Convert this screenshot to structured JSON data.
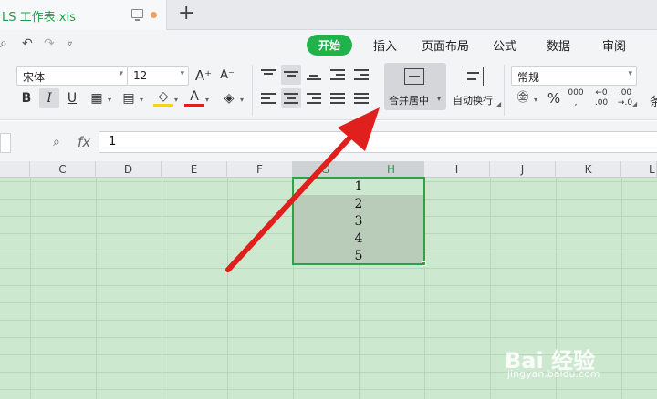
{
  "tab": {
    "filename": "LS 工作表.xls"
  },
  "menu": [
    "开始",
    "插入",
    "页面布局",
    "公式",
    "数据",
    "审阅"
  ],
  "font": {
    "name": "宋体",
    "size": "12"
  },
  "ribbon": {
    "merge_label": "合并居中",
    "wrap_label": "自动换行",
    "number_format": "常规"
  },
  "formula": {
    "fx_label": "fx",
    "value": "1"
  },
  "columns": [
    "C",
    "D",
    "E",
    "F",
    "G",
    "H",
    "I",
    "J",
    "K",
    "L"
  ],
  "cells": [
    "1",
    "2",
    "3",
    "4",
    "5"
  ],
  "watermark": {
    "brand": "Bai 经验",
    "url": "jingyan.baidu.com"
  },
  "colors": {
    "accent": "#21b24c",
    "sheet_bg": "#cce8cf",
    "arrow": "#e0201c"
  }
}
